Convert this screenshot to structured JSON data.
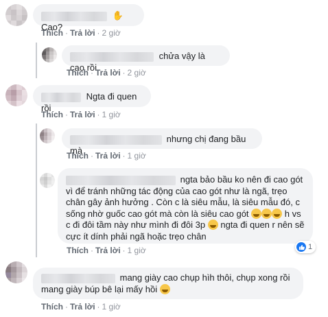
{
  "labels": {
    "like": "Thích",
    "reply": "Trả lời",
    "dot": "·"
  },
  "comments": [
    {
      "text": "Cao?",
      "time": "2 giờ"
    },
    {
      "text": "chửa vậy là cao rồi",
      "time": "2 giờ"
    },
    {
      "text": "Ngta đi quen rồi",
      "time": "1 giờ"
    },
    {
      "text": "nhưng chị đang bầu mà",
      "time": "1 giờ"
    },
    {
      "text_line1": "ngta bảo bầu ko nên đi cao gót vì để",
      "text_rest": "tránh những tác động của cao gót như là ngã, trẹo chân gây ảnh hưởng . Còn c là siêu mẫu, là siêu mẫu đó, c sống nhờ guốc cao gót mà còn là siêu cao gót",
      "text_mid": "h vs c đi đôi tầm này như mình đi đôi 3p",
      "text_end": "ngta đi quen r nên sẽ cực ít dính phải ngã hoặc trẹo chân",
      "time": "1 giờ",
      "reaction_count": "1"
    },
    {
      "text": "mang giày cao chụp hìh thôi, chụp xong rồi mang giày búp bê lại mấy hồi",
      "time": "1 giờ"
    }
  ],
  "colors": {
    "like_blue": "#1877f2",
    "emoji_yellow": "#f7c74a"
  }
}
